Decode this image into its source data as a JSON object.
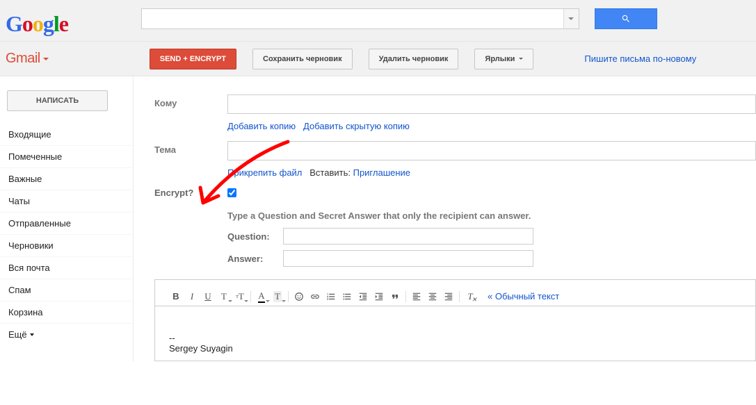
{
  "header": {
    "logo_text": "Google"
  },
  "product": {
    "name": "Gmail"
  },
  "actions": {
    "send_encrypt": "SEND + ENCRYPT",
    "save_draft": "Сохранить черновик",
    "delete_draft": "Удалить черновик",
    "labels": "Ярлыки",
    "new_compose_link": "Пишите письма по-новому"
  },
  "sidebar": {
    "compose": "НАПИСАТЬ",
    "items": [
      "Входящие",
      "Помеченные",
      "Важные",
      "Чаты",
      "Отправленные",
      "Черновики",
      "Вся почта",
      "Спам",
      "Корзина"
    ],
    "more": "Ещё"
  },
  "compose": {
    "to_label": "Кому",
    "add_cc": "Добавить копию",
    "add_bcc": "Добавить скрытую копию",
    "subject_label": "Тема",
    "attach": "Прикрепить файл",
    "insert_label": "Вставить:",
    "invitation": "Приглашение",
    "encrypt_label": "Encrypt?",
    "encrypt_checked": true,
    "hint": "Type a Question and Secret Answer that only the recipient can answer.",
    "question_label": "Question:",
    "answer_label": "Answer:",
    "plain_text": "« Обычный текст",
    "signature_prefix": "--",
    "signature": "Sergey Suyagin"
  },
  "colors": {
    "accent_red": "#dd4b39",
    "link": "#1155cc",
    "search_blue": "#4285f4"
  }
}
